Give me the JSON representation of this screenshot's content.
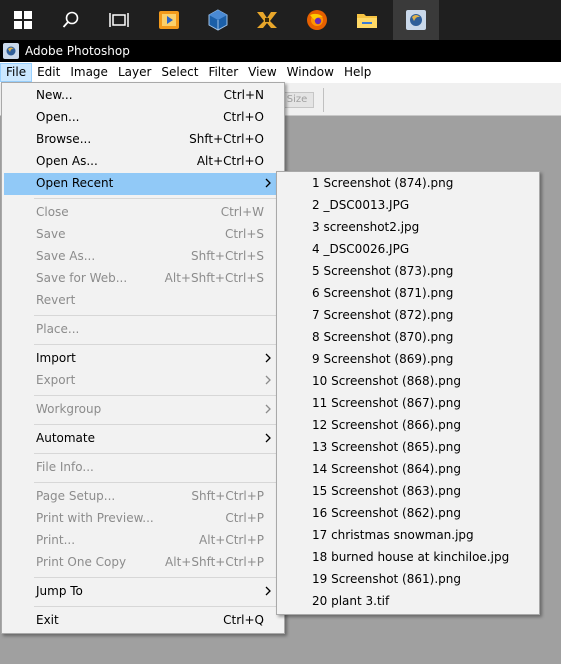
{
  "window": {
    "title": "Adobe Photoshop"
  },
  "menubar": [
    "File",
    "Edit",
    "Image",
    "Layer",
    "Select",
    "Filter",
    "View",
    "Window",
    "Help"
  ],
  "options_bar": {
    "size_button": "Size"
  },
  "file_menu": {
    "items": [
      {
        "label": "New...",
        "shortcut": "Ctrl+N"
      },
      {
        "label": "Open...",
        "shortcut": "Ctrl+O"
      },
      {
        "label": "Browse...",
        "shortcut": "Shft+Ctrl+O"
      },
      {
        "label": "Open As...",
        "shortcut": "Alt+Ctrl+O"
      },
      {
        "label": "Open Recent",
        "shortcut": ""
      },
      {
        "label": "Close",
        "shortcut": "Ctrl+W"
      },
      {
        "label": "Save",
        "shortcut": "Ctrl+S"
      },
      {
        "label": "Save As...",
        "shortcut": "Shft+Ctrl+S"
      },
      {
        "label": "Save for Web...",
        "shortcut": "Alt+Shft+Ctrl+S"
      },
      {
        "label": "Revert",
        "shortcut": ""
      },
      {
        "label": "Place...",
        "shortcut": ""
      },
      {
        "label": "Import",
        "shortcut": ""
      },
      {
        "label": "Export",
        "shortcut": ""
      },
      {
        "label": "Workgroup",
        "shortcut": ""
      },
      {
        "label": "Automate",
        "shortcut": ""
      },
      {
        "label": "File Info...",
        "shortcut": ""
      },
      {
        "label": "Page Setup...",
        "shortcut": "Shft+Ctrl+P"
      },
      {
        "label": "Print with Preview...",
        "shortcut": "Ctrl+P"
      },
      {
        "label": "Print...",
        "shortcut": "Alt+Ctrl+P"
      },
      {
        "label": "Print One Copy",
        "shortcut": "Alt+Shft+Ctrl+P"
      },
      {
        "label": "Jump To",
        "shortcut": ""
      },
      {
        "label": "Exit",
        "shortcut": "Ctrl+Q"
      }
    ]
  },
  "open_recent_menu": {
    "items": [
      "1 Screenshot (874).png",
      "2 _DSC0013.JPG",
      "3 screenshot2.jpg",
      "4 _DSC0026.JPG",
      "5 Screenshot (873).png",
      "6 Screenshot (871).png",
      "7 Screenshot (872).png",
      "8 Screenshot (870).png",
      "9 Screenshot (869).png",
      "10 Screenshot (868).png",
      "11 Screenshot (867).png",
      "12 Screenshot (866).png",
      "13 Screenshot (865).png",
      "14 Screenshot (864).png",
      "15 Screenshot (863).png",
      "16 Screenshot (862).png",
      "17 christmas snowman.jpg",
      "18 burned house at kinchiloe.jpg",
      "19 Screenshot (861).png",
      "20 plant 3.tif"
    ]
  },
  "colors": {
    "highlight": "#91c9f7",
    "menu_bg": "#f2f2f2",
    "disabled_text": "#8c8c8c",
    "taskbar": "#1f1f1f"
  }
}
